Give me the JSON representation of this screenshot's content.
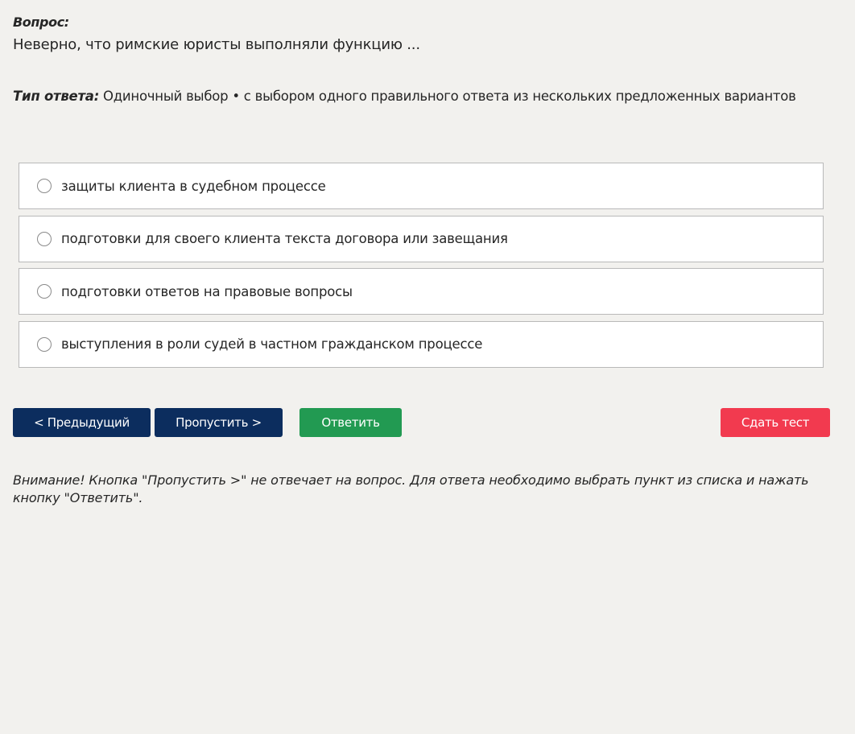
{
  "question": {
    "label": "Вопрос:",
    "text": "Неверно, что римские юристы выполняли функцию ..."
  },
  "answer_type": {
    "label": "Тип ответа:",
    "value": " Одиночный выбор • с выбором одного правильного ответа из нескольких предложенных вариантов"
  },
  "options": [
    {
      "label": "защиты клиента в судебном процессе",
      "selected": false
    },
    {
      "label": "подготовки для своего клиента текста договора или завещания",
      "selected": false
    },
    {
      "label": "подготовки ответов на правовые вопросы",
      "selected": false
    },
    {
      "label": "выступления в роли судей в частном гражданском процессе",
      "selected": false
    }
  ],
  "buttons": {
    "prev": "< Предыдущий",
    "skip": "Пропустить >",
    "answer": "Ответить",
    "submit": "Сдать тест"
  },
  "colors": {
    "nav": "#0c2d5e",
    "answer": "#229a52",
    "submit": "#f23a4f",
    "background": "#f2f1ee"
  },
  "notice": "Внимание! Кнопка \"Пропустить >\" не отвечает на вопрос. Для ответа необходимо выбрать пункт из списка и нажать кнопку \"Ответить\"."
}
